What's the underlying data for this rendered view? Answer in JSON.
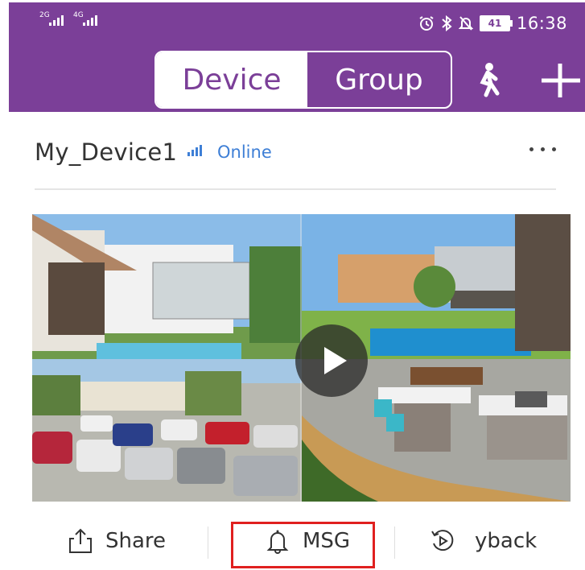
{
  "status_bar": {
    "signal1_label": "2G",
    "signal2_label": "4G",
    "battery": "41",
    "time": "16:38"
  },
  "header": {
    "tabs": [
      {
        "label": "Device",
        "active": true
      },
      {
        "label": "Group",
        "active": false
      }
    ],
    "accent_color": "#7b3f98",
    "icons": [
      "walking-person-icon",
      "plus-icon"
    ]
  },
  "device": {
    "name": "My_Device1",
    "status": "Online",
    "status_color": "#3e7fd6"
  },
  "actions": {
    "share_label": "Share",
    "msg_label": "MSG",
    "playback_label": "yback"
  }
}
